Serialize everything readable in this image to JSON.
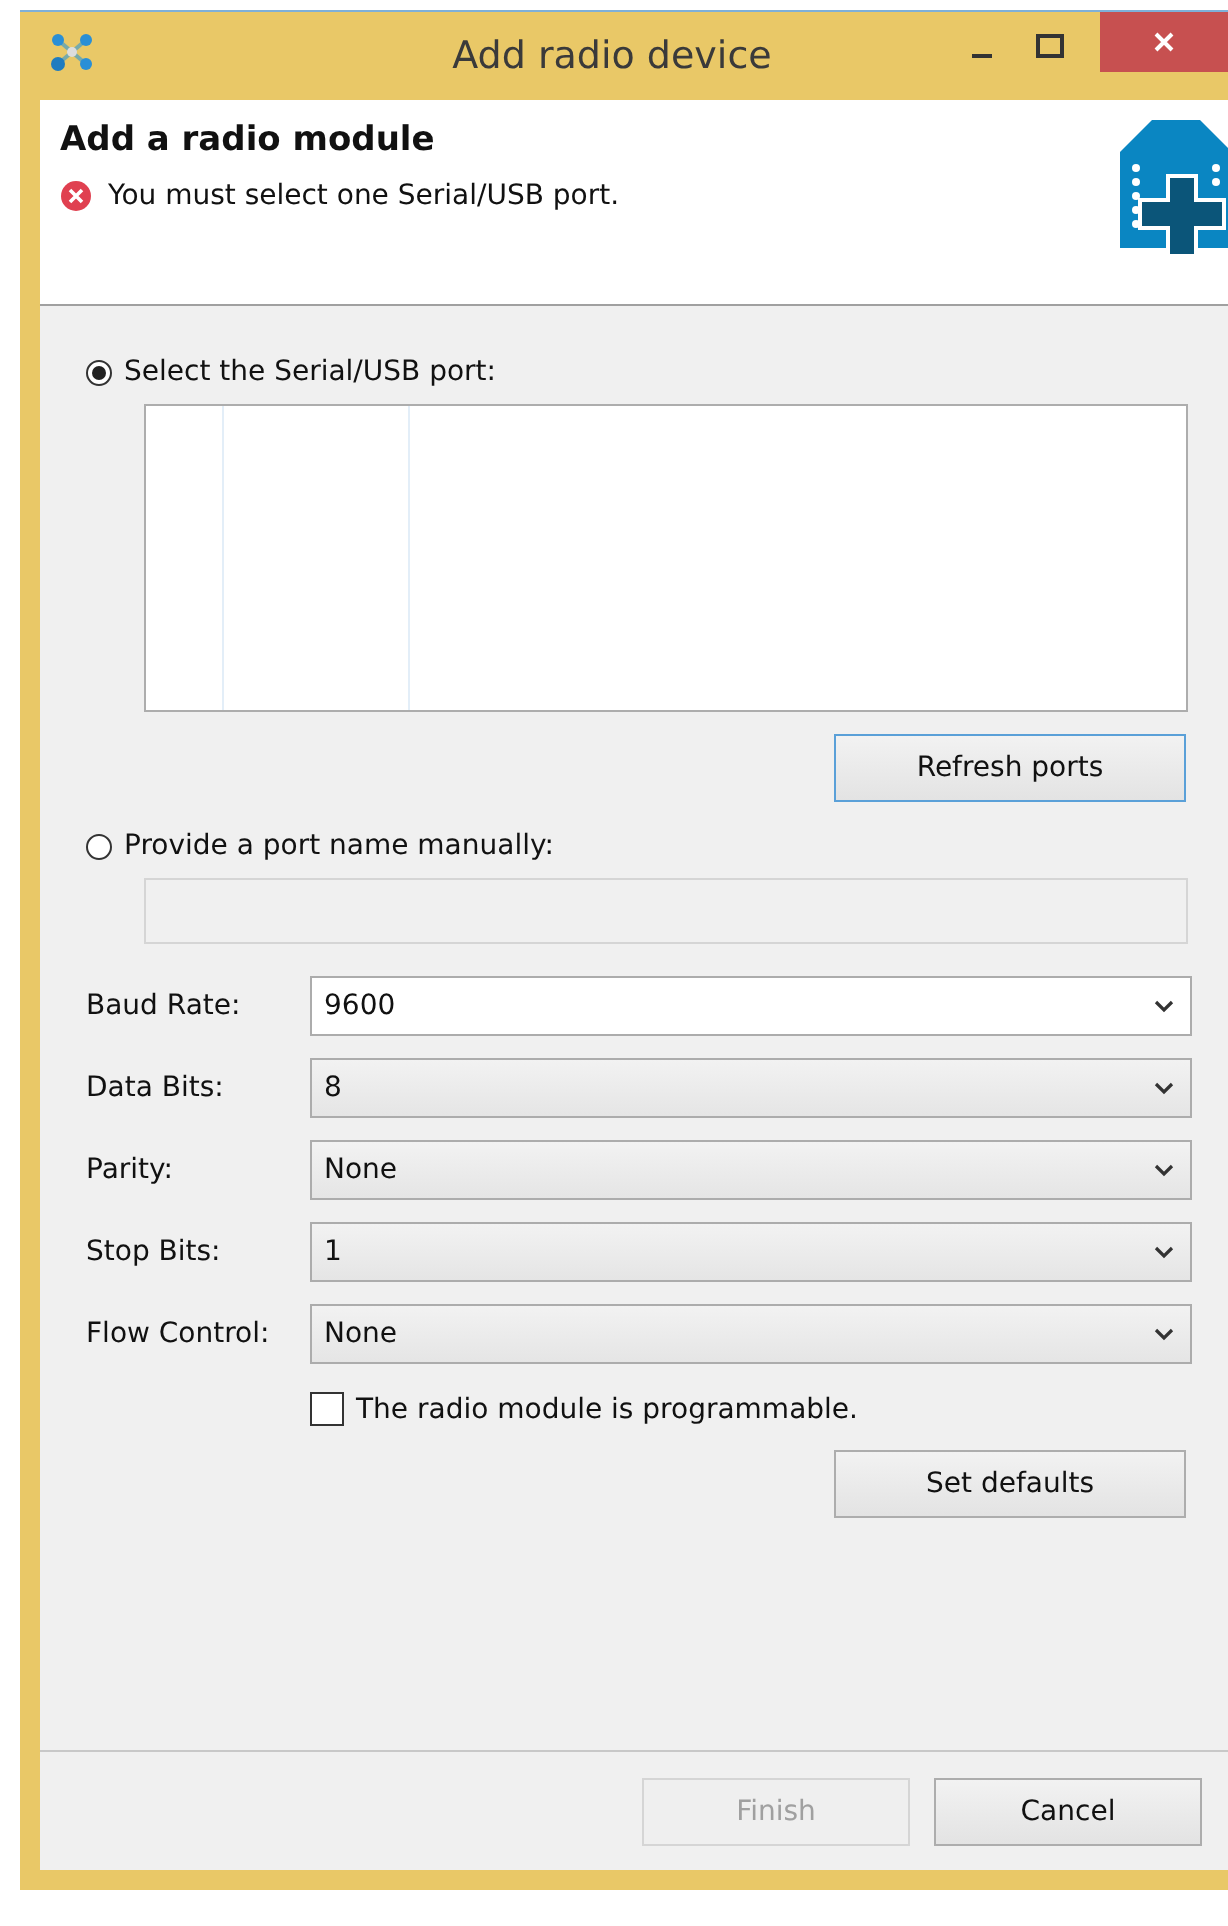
{
  "window": {
    "title": "Add radio device"
  },
  "header": {
    "title": "Add a radio module",
    "error": "You must select one Serial/USB port."
  },
  "port_source": [
    {
      "label": "Select the Serial/USB port:",
      "selected": true,
      "kind": "list"
    },
    {
      "label": "Provide a port name manually:",
      "selected": false,
      "kind": "text",
      "disabled": true
    }
  ],
  "refresh_button": "Refresh ports",
  "settings": [
    {
      "label": "Baud Rate:",
      "value": "9600",
      "kind": "editable"
    },
    {
      "label": "Data Bits:",
      "value": "8",
      "kind": "readonly"
    },
    {
      "label": "Parity:",
      "value": "None",
      "kind": "readonly"
    },
    {
      "label": "Stop Bits:",
      "value": "1",
      "kind": "readonly"
    },
    {
      "label": "Flow Control:",
      "value": "None",
      "kind": "readonly"
    }
  ],
  "programmable": {
    "label": "The radio module is programmable.",
    "checked": false
  },
  "defaults_button": "Set defaults",
  "buttons": [
    {
      "label": "Finish",
      "disabled": true
    },
    {
      "label": "Cancel",
      "disabled": false
    }
  ]
}
